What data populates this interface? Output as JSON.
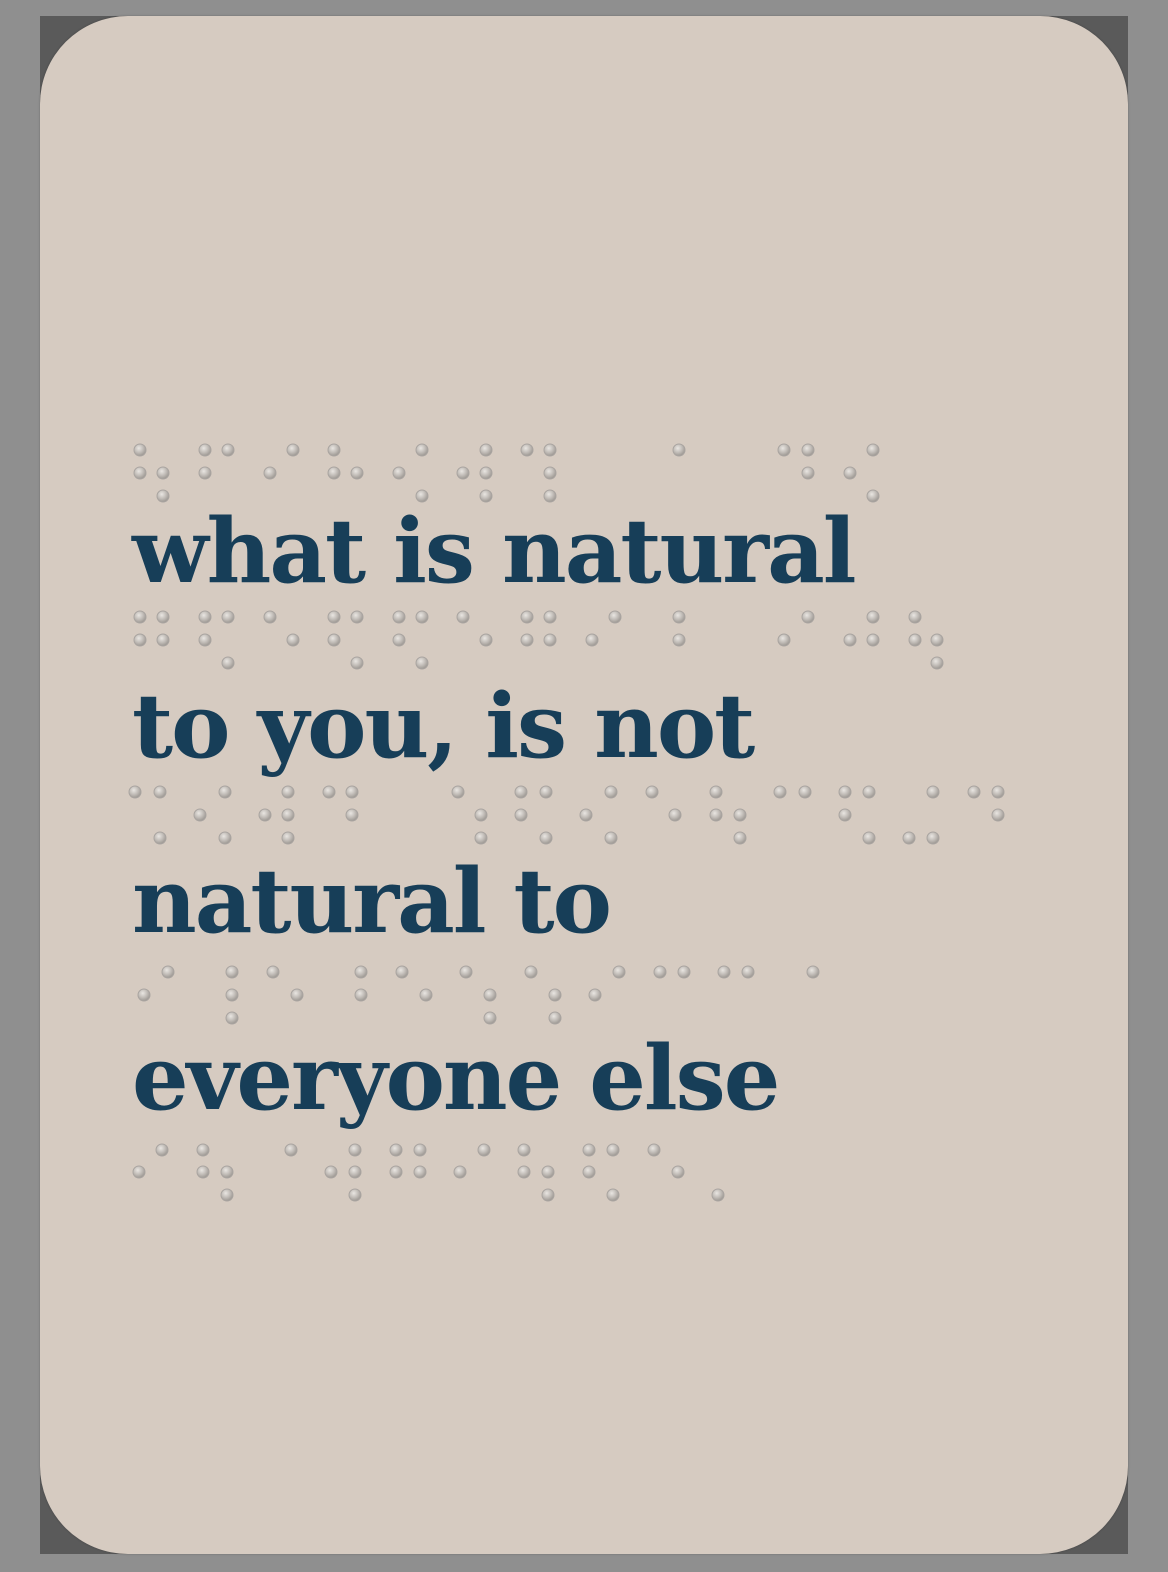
{
  "card": {
    "lines": [
      "what is natural",
      "to you, is not",
      "natural to",
      "everyone else"
    ]
  },
  "colors": {
    "background": "#8f8f8f",
    "backing": "#5a5a5a",
    "card": "#d6cbc1",
    "text": "#173e58",
    "braille_dot": "#b9b5b1"
  },
  "braille": {
    "description_only": "",
    "rows": [
      [
        [
          140,
          450
        ],
        [
          140,
          473
        ],
        [
          163,
          473
        ],
        [
          163,
          496
        ],
        [
          205,
          450
        ],
        [
          228,
          450
        ],
        [
          205,
          473
        ],
        [
          293,
          450
        ],
        [
          270,
          473
        ],
        [
          334,
          450
        ],
        [
          334,
          473
        ],
        [
          357,
          473
        ],
        [
          422,
          450
        ],
        [
          399,
          473
        ],
        [
          422,
          496
        ],
        [
          486,
          450
        ],
        [
          463,
          473
        ],
        [
          486,
          473
        ],
        [
          486,
          496
        ],
        [
          527,
          450
        ],
        [
          550,
          450
        ],
        [
          550,
          473
        ],
        [
          550,
          496
        ],
        [
          679,
          450
        ],
        [
          784,
          450
        ],
        [
          808,
          450
        ],
        [
          808,
          473
        ],
        [
          873,
          450
        ],
        [
          850,
          473
        ],
        [
          873,
          496
        ]
      ],
      [
        [
          140,
          617
        ],
        [
          163,
          617
        ],
        [
          140,
          640
        ],
        [
          163,
          640
        ],
        [
          205,
          617
        ],
        [
          228,
          617
        ],
        [
          205,
          640
        ],
        [
          228,
          663
        ],
        [
          270,
          617
        ],
        [
          293,
          640
        ],
        [
          334,
          617
        ],
        [
          357,
          617
        ],
        [
          334,
          640
        ],
        [
          357,
          663
        ],
        [
          399,
          617
        ],
        [
          422,
          617
        ],
        [
          399,
          640
        ],
        [
          422,
          663
        ],
        [
          463,
          617
        ],
        [
          486,
          640
        ],
        [
          527,
          617
        ],
        [
          550,
          617
        ],
        [
          527,
          640
        ],
        [
          550,
          640
        ],
        [
          592,
          640
        ],
        [
          615,
          617
        ],
        [
          679,
          617
        ],
        [
          679,
          640
        ],
        [
          808,
          617
        ],
        [
          784,
          640
        ],
        [
          873,
          617
        ],
        [
          850,
          640
        ],
        [
          873,
          640
        ],
        [
          915,
          617
        ],
        [
          915,
          640
        ],
        [
          937,
          640
        ],
        [
          937,
          663
        ]
      ],
      [
        [
          135,
          792
        ],
        [
          160,
          792
        ],
        [
          160,
          838
        ],
        [
          200,
          815
        ],
        [
          225,
          792
        ],
        [
          225,
          838
        ],
        [
          265,
          815
        ],
        [
          288,
          792
        ],
        [
          288,
          815
        ],
        [
          288,
          838
        ],
        [
          329,
          792
        ],
        [
          352,
          792
        ],
        [
          352,
          815
        ],
        [
          458,
          792
        ],
        [
          481,
          815
        ],
        [
          481,
          838
        ],
        [
          521,
          792
        ],
        [
          546,
          792
        ],
        [
          521,
          815
        ],
        [
          546,
          838
        ],
        [
          586,
          815
        ],
        [
          611,
          792
        ],
        [
          611,
          838
        ],
        [
          652,
          792
        ],
        [
          675,
          815
        ],
        [
          716,
          792
        ],
        [
          716,
          815
        ],
        [
          740,
          815
        ],
        [
          740,
          838
        ],
        [
          780,
          792
        ],
        [
          805,
          792
        ],
        [
          845,
          792
        ],
        [
          869,
          792
        ],
        [
          845,
          815
        ],
        [
          869,
          838
        ],
        [
          909,
          838
        ],
        [
          933,
          792
        ],
        [
          933,
          838
        ],
        [
          974,
          792
        ],
        [
          998,
          792
        ],
        [
          998,
          815
        ]
      ],
      [
        [
          144,
          995
        ],
        [
          168,
          972
        ],
        [
          232,
          972
        ],
        [
          232,
          995
        ],
        [
          232,
          1018
        ],
        [
          273,
          972
        ],
        [
          297,
          995
        ],
        [
          361,
          972
        ],
        [
          361,
          995
        ],
        [
          402,
          972
        ],
        [
          426,
          995
        ],
        [
          466,
          972
        ],
        [
          490,
          995
        ],
        [
          490,
          1018
        ],
        [
          531,
          972
        ],
        [
          555,
          995
        ],
        [
          555,
          1018
        ],
        [
          595,
          995
        ],
        [
          619,
          972
        ],
        [
          660,
          972
        ],
        [
          684,
          972
        ],
        [
          724,
          972
        ],
        [
          748,
          972
        ],
        [
          813,
          972
        ]
      ],
      [
        [
          139,
          1172
        ],
        [
          162,
          1150
        ],
        [
          203,
          1150
        ],
        [
          203,
          1172
        ],
        [
          227,
          1172
        ],
        [
          227,
          1195
        ],
        [
          291,
          1150
        ],
        [
          331,
          1172
        ],
        [
          355,
          1150
        ],
        [
          355,
          1172
        ],
        [
          355,
          1195
        ],
        [
          396,
          1150
        ],
        [
          420,
          1150
        ],
        [
          396,
          1172
        ],
        [
          420,
          1172
        ],
        [
          460,
          1172
        ],
        [
          484,
          1150
        ],
        [
          524,
          1150
        ],
        [
          524,
          1172
        ],
        [
          548,
          1172
        ],
        [
          548,
          1195
        ],
        [
          589,
          1150
        ],
        [
          613,
          1150
        ],
        [
          589,
          1172
        ],
        [
          613,
          1195
        ],
        [
          654,
          1150
        ],
        [
          678,
          1172
        ],
        [
          718,
          1195
        ]
      ]
    ]
  }
}
